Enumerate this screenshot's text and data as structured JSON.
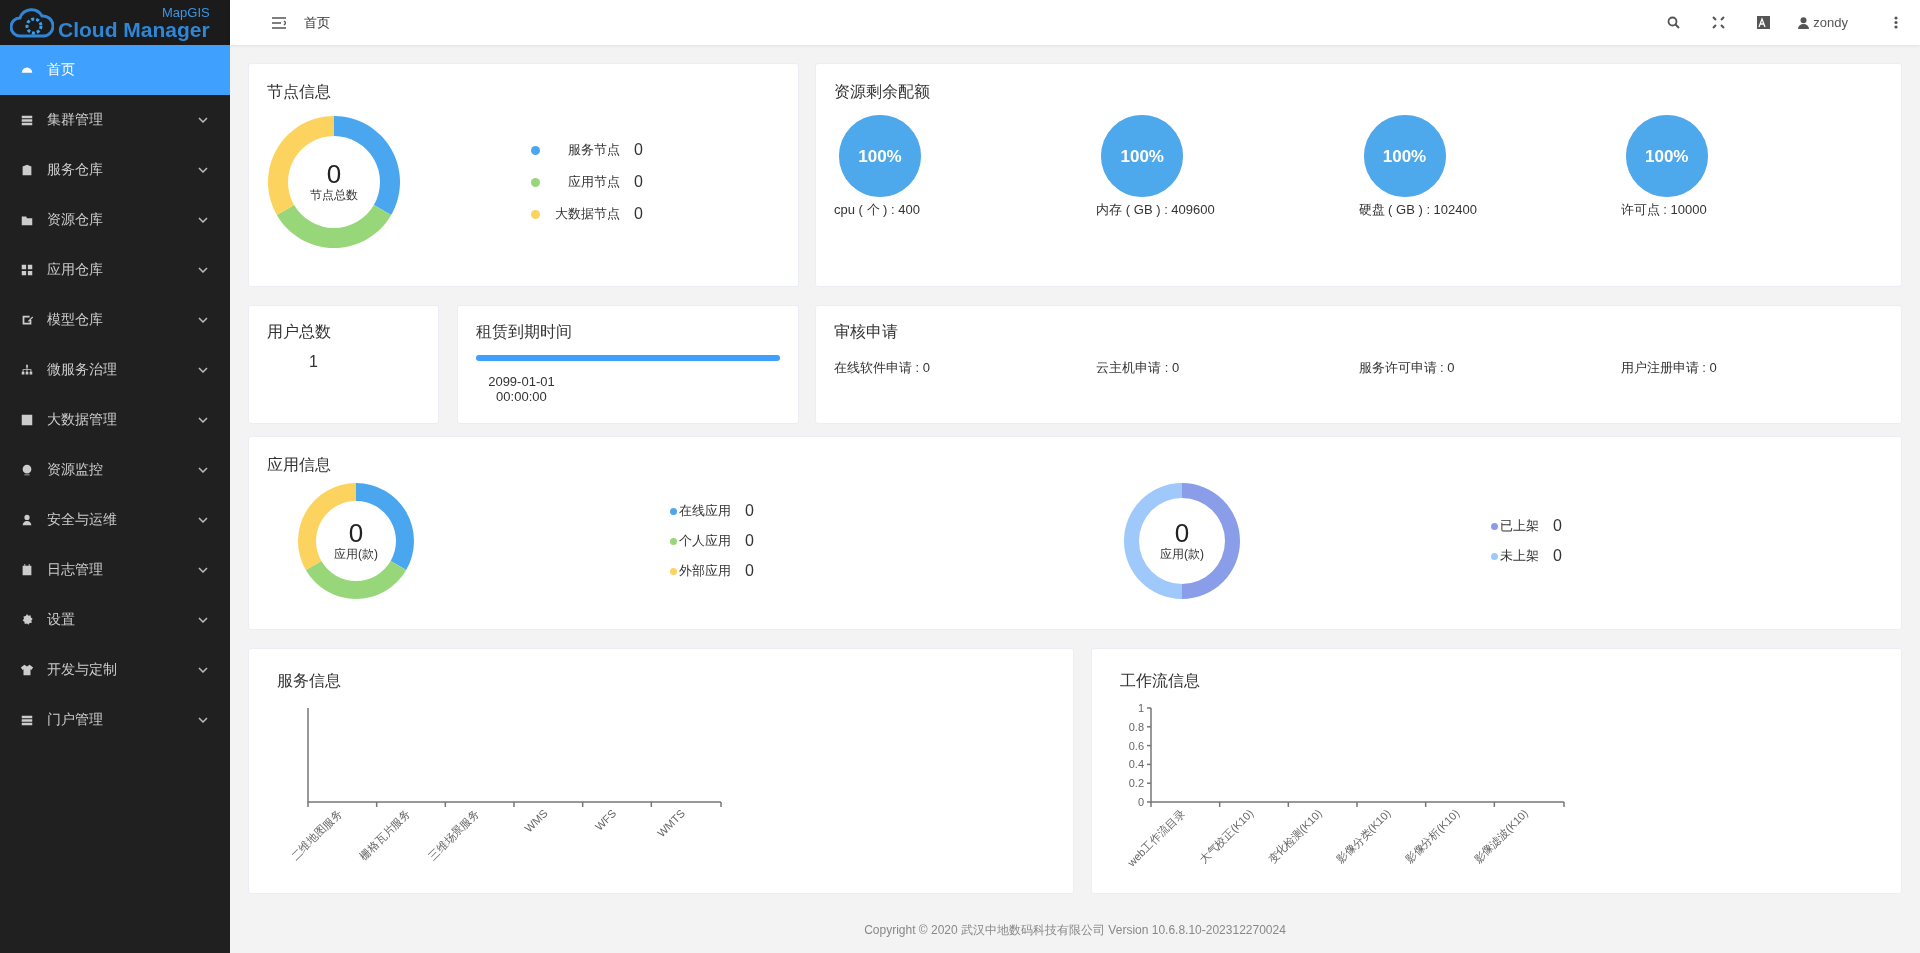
{
  "logo": {
    "brand": "MapGIS",
    "product": "Cloud Manager"
  },
  "sidebar": {
    "items": [
      {
        "label": "首页",
        "selected": true,
        "expandable": false
      },
      {
        "label": "集群管理",
        "selected": false,
        "expandable": true
      },
      {
        "label": "服务仓库",
        "selected": false,
        "expandable": true
      },
      {
        "label": "资源仓库",
        "selected": false,
        "expandable": true
      },
      {
        "label": "应用仓库",
        "selected": false,
        "expandable": true
      },
      {
        "label": "模型仓库",
        "selected": false,
        "expandable": true
      },
      {
        "label": "微服务治理",
        "selected": false,
        "expandable": true
      },
      {
        "label": "大数据管理",
        "selected": false,
        "expandable": true
      },
      {
        "label": "资源监控",
        "selected": false,
        "expandable": true
      },
      {
        "label": "安全与运维",
        "selected": false,
        "expandable": true
      },
      {
        "label": "日志管理",
        "selected": false,
        "expandable": true
      },
      {
        "label": "设置",
        "selected": false,
        "expandable": true
      },
      {
        "label": "开发与定制",
        "selected": false,
        "expandable": true
      },
      {
        "label": "门户管理",
        "selected": false,
        "expandable": true
      }
    ]
  },
  "header": {
    "breadcrumb": "首页",
    "user": "zondy"
  },
  "node_info": {
    "title": "节点信息",
    "total": "0",
    "total_label": "节点总数",
    "legend": [
      {
        "label": "服务节点",
        "value": "0",
        "color": "#4aa6ee"
      },
      {
        "label": "应用节点",
        "value": "0",
        "color": "#97d77a"
      },
      {
        "label": "大数据节点",
        "value": "0",
        "color": "#fdd35f"
      }
    ]
  },
  "resource_quota": {
    "title": "资源剩余配额",
    "items": [
      {
        "percent": "100%",
        "level": 1,
        "label": "cpu ( 个 ) : 400"
      },
      {
        "percent": "100%",
        "level": 1,
        "label": "内存 ( GB ) : 409600"
      },
      {
        "percent": "100%",
        "level": 1,
        "label": "硬盘 ( GB ) : 102400"
      },
      {
        "percent": "100%",
        "level": 1,
        "label": "许可点 : 10000"
      }
    ]
  },
  "user_total": {
    "title": "用户总数",
    "value": "1"
  },
  "lease": {
    "title": "租赁到期时间",
    "level": 1,
    "date": "2099-01-01",
    "time": "00:00:00"
  },
  "audit": {
    "title": "审核申请",
    "items": [
      "在线软件申请 : 0",
      "云主机申请 : 0",
      "服务许可申请 : 0",
      "用户注册申请 : 0"
    ]
  },
  "app_info": {
    "title": "应用信息",
    "donuts": [
      {
        "total": "0",
        "total_label": "应用(款)",
        "legend": [
          {
            "label": "在线应用",
            "value": "0",
            "color": "#4aa6ee"
          },
          {
            "label": "个人应用",
            "value": "0",
            "color": "#97d77a"
          },
          {
            "label": "外部应用",
            "value": "0",
            "color": "#fdd35f"
          }
        ]
      },
      {
        "total": "0",
        "total_label": "应用(款)",
        "legend": [
          {
            "label": "已上架",
            "value": "0",
            "color": "#8a9de8"
          },
          {
            "label": "未上架",
            "value": "0",
            "color": "#9ec9fa"
          }
        ]
      }
    ]
  },
  "service_info": {
    "title": "服务信息",
    "chart_data": {
      "type": "other",
      "categories": [
        "二维地图服务",
        "栅格瓦片服务",
        "三维场景服务",
        "WMS",
        "WFS",
        "WMTS"
      ]
    }
  },
  "workflow_info": {
    "title": "工作流信息",
    "chart_data": {
      "type": "bar",
      "categories": [
        "web工作流目录",
        "大气校正(K10)",
        "变化检测(K10)",
        "影像分类(K10)",
        "影像分析(K10)",
        "影像滤波(K10)"
      ],
      "values": [
        0,
        0,
        0,
        0,
        0,
        0
      ],
      "ylim": [
        0,
        1
      ],
      "yticks": [
        0,
        0.2,
        0.4,
        0.6,
        0.8,
        1
      ]
    }
  },
  "footer": "Copyright © 2020 武汉中地数码科技有限公司 Version 10.6.8.10-202312270024"
}
